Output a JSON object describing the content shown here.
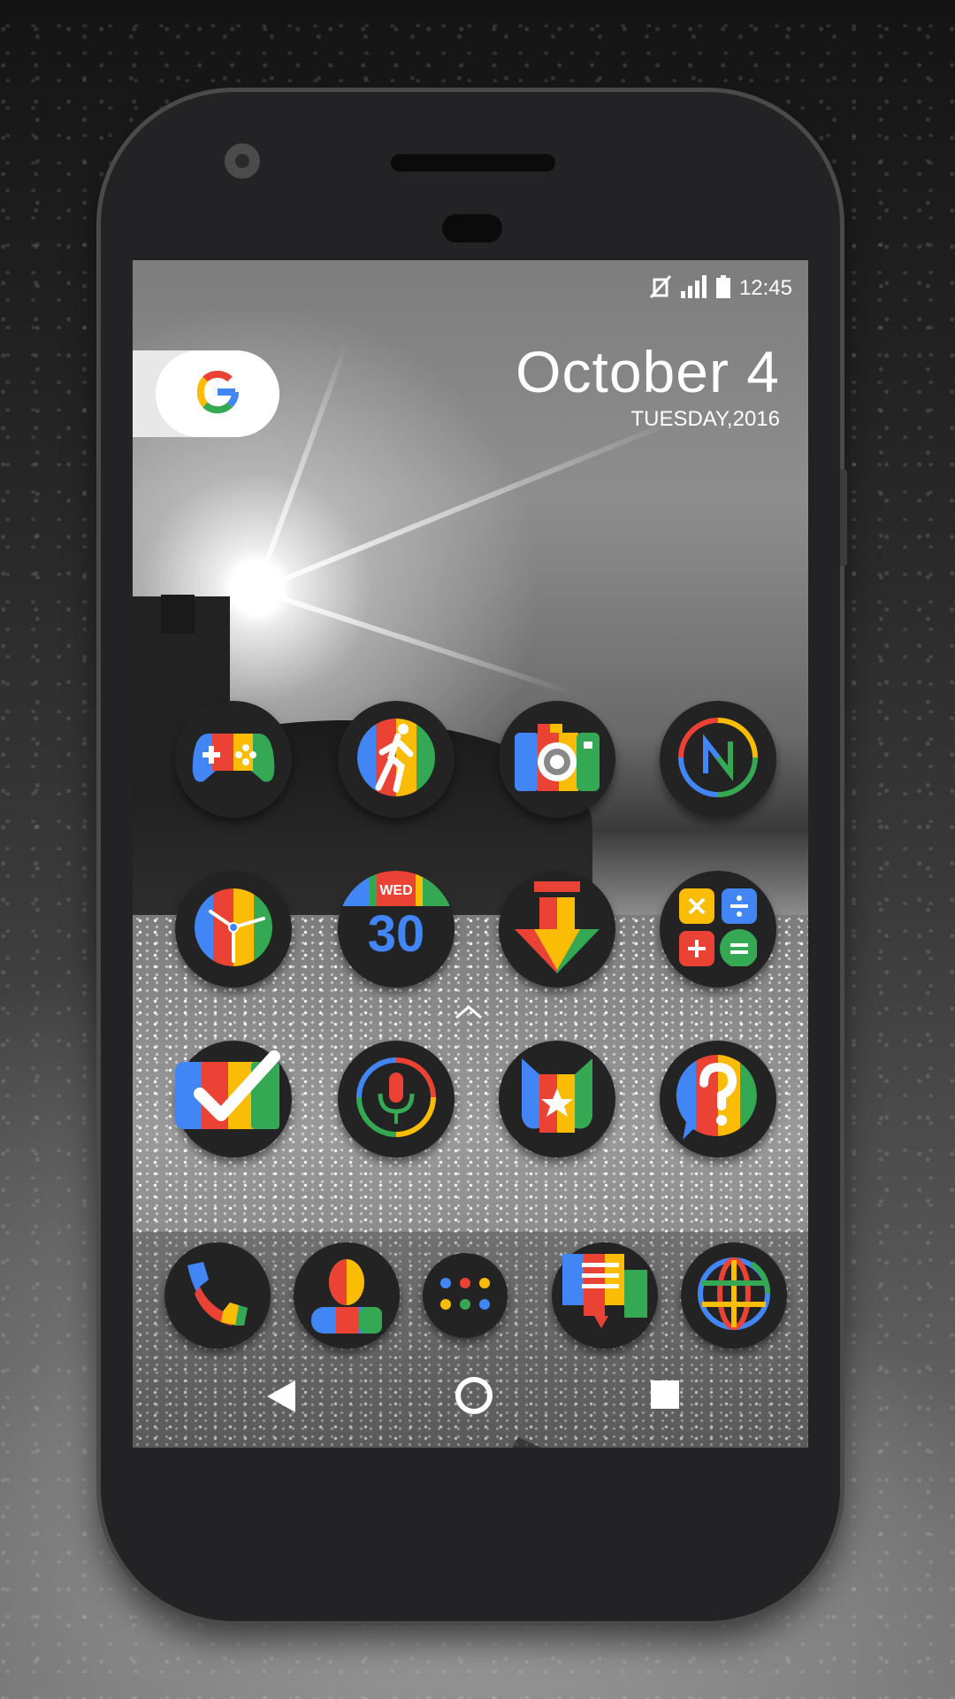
{
  "status_bar": {
    "time": "12:45",
    "icons": [
      "vibrate-off-icon",
      "signal-icon",
      "battery-icon"
    ]
  },
  "search_widget": {
    "logo": "google-g-icon"
  },
  "date_widget": {
    "date": "October 4",
    "weekday_year": "TUESDAY,2016"
  },
  "home_icons": [
    {
      "name": "game-controller-icon"
    },
    {
      "name": "fitness-runner-icon"
    },
    {
      "name": "camera-icon"
    },
    {
      "name": "news-n-icon"
    },
    {
      "name": "clock-icon"
    },
    {
      "name": "calendar-icon",
      "day": "WED",
      "date": "30"
    },
    {
      "name": "download-arrow-icon"
    },
    {
      "name": "calculator-icon"
    },
    {
      "name": "tasks-check-icon"
    },
    {
      "name": "voice-mic-icon"
    },
    {
      "name": "star-bookmark-icon"
    },
    {
      "name": "help-question-icon"
    }
  ],
  "dock_icons": [
    {
      "name": "phone-icon"
    },
    {
      "name": "contacts-icon"
    },
    {
      "name": "app-drawer-icon"
    },
    {
      "name": "messages-icon"
    },
    {
      "name": "browser-globe-icon"
    }
  ],
  "nav_bar": [
    "back-icon",
    "home-icon",
    "recents-icon"
  ],
  "colors": {
    "blue": "#4285F4",
    "red": "#EA4335",
    "yellow": "#FBBC05",
    "green": "#34A853",
    "icon_bg": "#232323",
    "phone_body": "#232325"
  }
}
